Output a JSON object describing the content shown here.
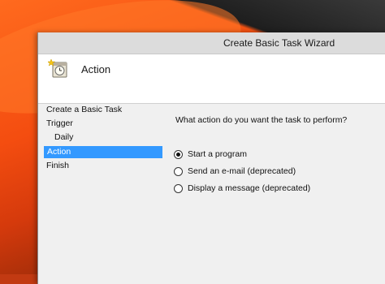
{
  "window": {
    "title": "Create Basic Task Wizard"
  },
  "header": {
    "title": "Action",
    "icon": "task-scheduler-icon"
  },
  "steps": [
    {
      "label": "Create a Basic Task",
      "active": false
    },
    {
      "label": "Trigger",
      "active": false
    },
    {
      "label": "Daily",
      "active": false
    },
    {
      "label": "Action",
      "active": true
    },
    {
      "label": "Finish",
      "active": false
    }
  ],
  "content": {
    "question": "What action do you want the task to perform?",
    "options": [
      {
        "label": "Start a program",
        "checked": true
      },
      {
        "label": "Send an e-mail (deprecated)",
        "checked": false
      },
      {
        "label": "Display a message (deprecated)",
        "checked": false
      }
    ]
  },
  "colors": {
    "selection": "#3399ff",
    "desktop_accent": "#f44d10"
  }
}
